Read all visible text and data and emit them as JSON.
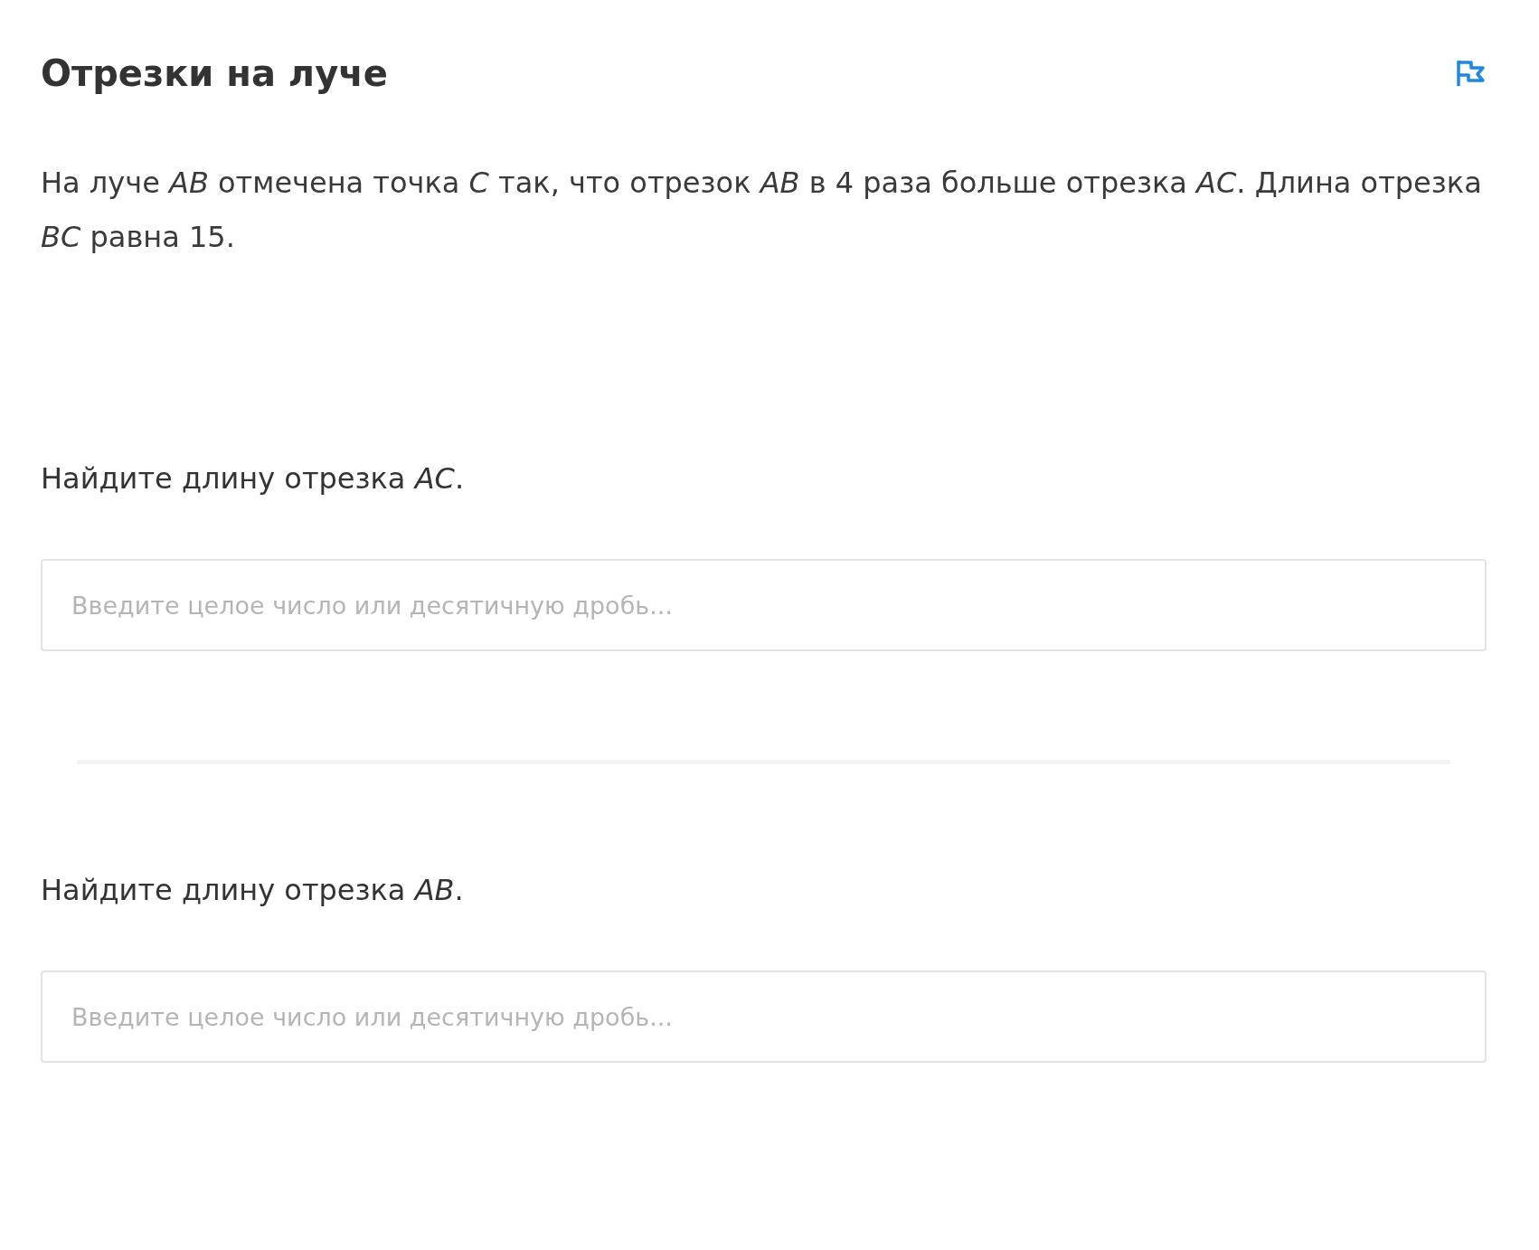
{
  "title": "Отрезки на луче",
  "problem": "На луче *AB* отмечена точка *C* так, что отрезок *AB* в 4 раза больше отрезка *AC*. Длина отрезка *BC* равна 15.",
  "questions": [
    {
      "prompt": "Найдите длину отрезка *AC*.",
      "placeholder": "Введите целое число или десятичную дробь..."
    },
    {
      "prompt": "Найдите длину отрезка *AB*.",
      "placeholder": "Введите целое число или десятичную дробь..."
    }
  ]
}
